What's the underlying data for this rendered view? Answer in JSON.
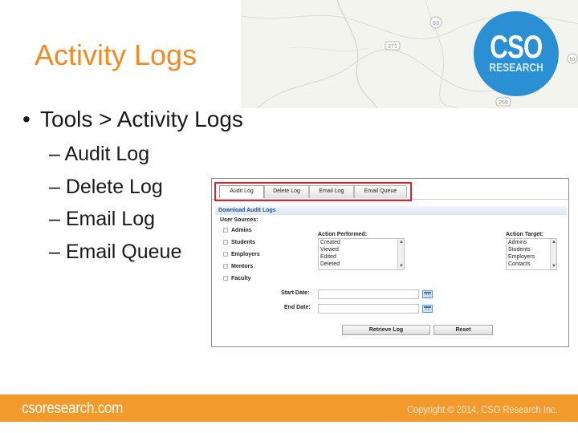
{
  "slide": {
    "title": "Activity Logs",
    "bullet": "Tools > Activity Logs",
    "bullet_marker": "•",
    "sub_items": [
      "– Audit Log",
      "– Delete Log",
      "– Email Log",
      "– Email Queue"
    ]
  },
  "logo": {
    "main": "CSO",
    "sub": "RESEARCH"
  },
  "map": {
    "route_labels": [
      "63",
      "271",
      "259",
      "50"
    ]
  },
  "screenshot": {
    "tabs": [
      "Audit Log",
      "Delete Log",
      "Email Log",
      "Email Queue"
    ],
    "active_tab": "Audit Log",
    "section_title": "Download Audit Logs",
    "user_sources_label": "User Sources:",
    "user_sources": [
      "Admins",
      "Students",
      "Employers",
      "Mentors",
      "Faculty"
    ],
    "action_performed_label": "Action Performed:",
    "action_performed": [
      "Created",
      "Viewed",
      "Edited",
      "Deleted"
    ],
    "action_target_label": "Action Target:",
    "action_target": [
      "Admins",
      "Students",
      "Employers",
      "Contacts"
    ],
    "start_date_label": "Start Date:",
    "end_date_label": "End Date:",
    "start_date_value": "",
    "end_date_value": "",
    "retrieve_label": "Retrieve Log",
    "reset_label": "Reset"
  },
  "footer": {
    "site": "csoresearch.com",
    "copyright": "Copyright © 2014, CSO Research Inc."
  },
  "colors": {
    "title": "#ef8a25",
    "footer": "#f39a2c",
    "logo": "#2a8fd3",
    "highlight": "#d9252a"
  }
}
